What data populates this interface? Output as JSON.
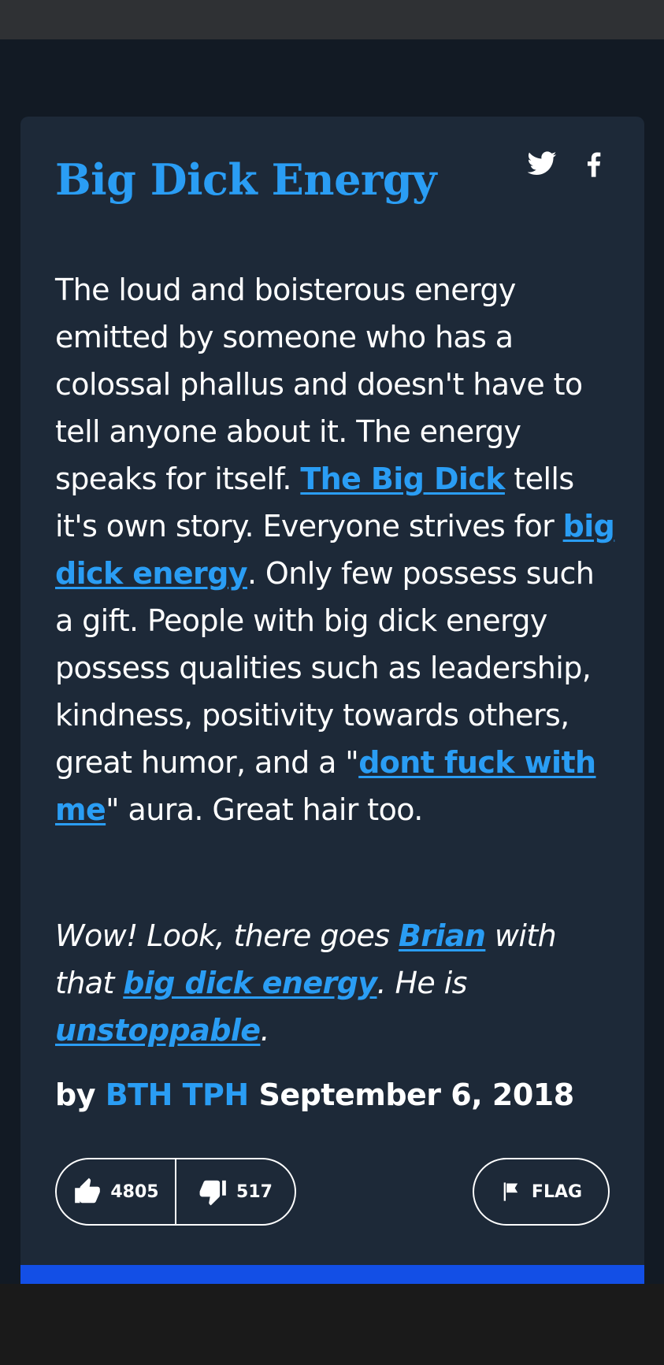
{
  "entry": {
    "title": "Big Dick Energy",
    "definition": {
      "p1": "The loud and boisterous energy emitted by someone who has a colossal phallus and doesn't have to tell anyone about it. The energy speaks for itself. ",
      "link1": "The Big Dick",
      "p2": " tells it's own story. Everyone strives for ",
      "link2": "big dick energy",
      "p3": ". Only few possess such a gift. People with big dick energy possess qualities such as leadership, kindness, positivity towards others, great humor, and a \"",
      "link3": "dont fuck with me",
      "p4": "\" aura. Great hair too."
    },
    "example": {
      "p1": "Wow! Look, there goes ",
      "link1": "Brian",
      "p2": " with that ",
      "link2": "big dick energy",
      "p3": ". He is ",
      "link3": "unstoppable",
      "p4": "."
    },
    "byline": {
      "prefix": "by",
      "author": "BTH TPH",
      "date": "September 6, 2018"
    },
    "votes": {
      "up": "4805",
      "down": "517"
    },
    "flag_label": "FLAG"
  },
  "share": {
    "icons": [
      "twitter-icon",
      "facebook-icon"
    ]
  },
  "colors": {
    "link": "#2a9df4",
    "card": "#1d2938",
    "accent_bar": "#134fe6"
  }
}
